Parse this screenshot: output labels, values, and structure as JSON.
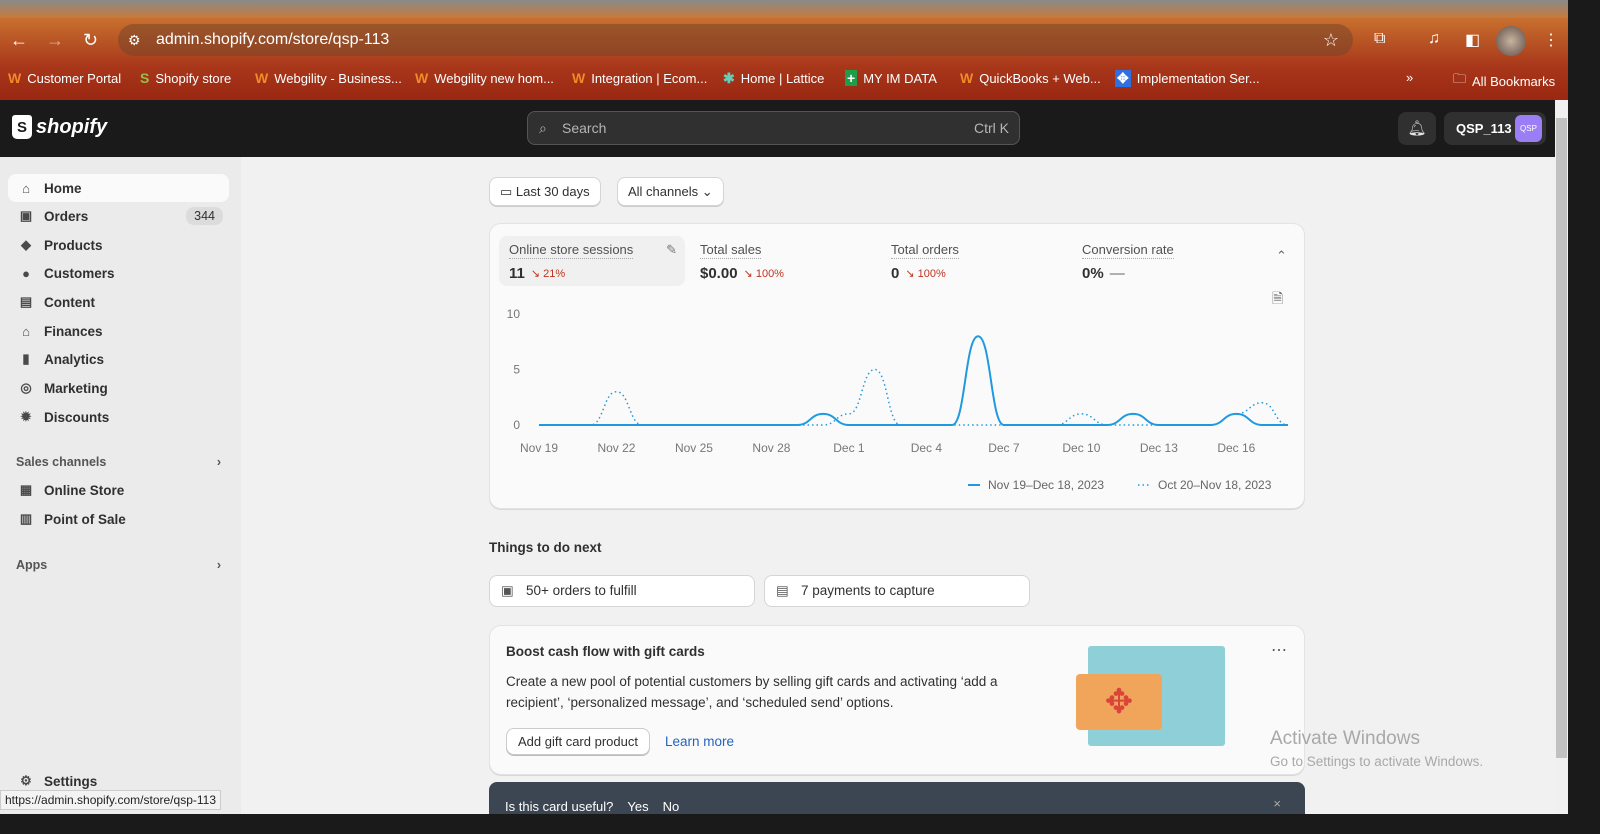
{
  "browser": {
    "url": "admin.shopify.com/store/qsp-113",
    "status_url": "https://admin.shopify.com/store/qsp-113",
    "bookmarks": [
      "Customer Portal",
      "Shopify store",
      "Webgility - Business...",
      "Webgility new hom...",
      "Integration | Ecom...",
      "Home | Lattice",
      "MY IM DATA",
      "QuickBooks + Web...",
      "Implementation Ser..."
    ],
    "all_bookmarks": "All Bookmarks"
  },
  "topbar": {
    "logo": "shopify",
    "search_placeholder": "Search",
    "search_shortcut": "Ctrl K",
    "account": "QSP_113",
    "account_initials": "QSP"
  },
  "sidebar": {
    "items": [
      {
        "label": "Home",
        "icon": "home-icon"
      },
      {
        "label": "Orders",
        "badge": "344",
        "icon": "orders-icon"
      },
      {
        "label": "Products",
        "icon": "tag-icon"
      },
      {
        "label": "Customers",
        "icon": "person-icon"
      },
      {
        "label": "Content",
        "icon": "content-icon"
      },
      {
        "label": "Finances",
        "icon": "bank-icon"
      },
      {
        "label": "Analytics",
        "icon": "bar-chart-icon"
      },
      {
        "label": "Marketing",
        "icon": "target-icon"
      },
      {
        "label": "Discounts",
        "icon": "discount-icon"
      }
    ],
    "sales_channels": "Sales channels",
    "channels": [
      "Online Store",
      "Point of Sale"
    ],
    "apps": "Apps",
    "settings": "Settings"
  },
  "filters": {
    "date": "Last 30 days",
    "channel": "All channels"
  },
  "metrics": [
    {
      "label": "Online store sessions",
      "value": "11",
      "change": "21%"
    },
    {
      "label": "Total sales",
      "value": "$0.00",
      "change": "100%"
    },
    {
      "label": "Total orders",
      "value": "0",
      "change": "100%"
    },
    {
      "label": "Conversion rate",
      "value": "0%",
      "change": "—"
    }
  ],
  "chart_data": {
    "type": "line",
    "title": "Online store sessions",
    "ylim": [
      0,
      10
    ],
    "yticks": [
      "0",
      "5",
      "10"
    ],
    "xticks": [
      "Nov 19",
      "Nov 22",
      "Nov 25",
      "Nov 28",
      "Dec 1",
      "Dec 4",
      "Dec 7",
      "Dec 10",
      "Dec 13",
      "Dec 16"
    ],
    "series": [
      {
        "name": "Nov 19–Dec 18, 2023",
        "style": "solid",
        "values": [
          0,
          0,
          0,
          0,
          0,
          0,
          0,
          0,
          0,
          0,
          0,
          1,
          0,
          0,
          0,
          0,
          0,
          8,
          0,
          0,
          0,
          0,
          0,
          1,
          0,
          0,
          0,
          1,
          0,
          0
        ]
      },
      {
        "name": "Oct 20–Nov 18, 2023",
        "style": "dotted",
        "values": [
          0,
          0,
          0,
          3,
          0,
          0,
          0,
          0,
          0,
          0,
          0,
          0,
          1,
          5,
          0,
          0,
          0,
          0,
          0,
          0,
          0,
          1,
          0,
          0,
          0,
          0,
          0,
          1,
          2,
          0
        ]
      }
    ],
    "legend": "bottom-right",
    "color": "#1f9ae0"
  },
  "todo": {
    "title": "Things to do next",
    "items": [
      "50+ orders to fulfill",
      "7 payments to capture"
    ]
  },
  "giftcard": {
    "title": "Boost cash flow with gift cards",
    "body": "Create a new pool of potential customers by selling gift cards and activating ‘add a recipient’, ‘personalized message’, and ‘scheduled send’ options.",
    "primary": "Add gift card product",
    "secondary": "Learn more"
  },
  "feedback": {
    "question": "Is this card useful?",
    "yes": "Yes",
    "no": "No"
  },
  "watermark": {
    "title": "Activate Windows",
    "sub": "Go to Settings to activate Windows."
  }
}
